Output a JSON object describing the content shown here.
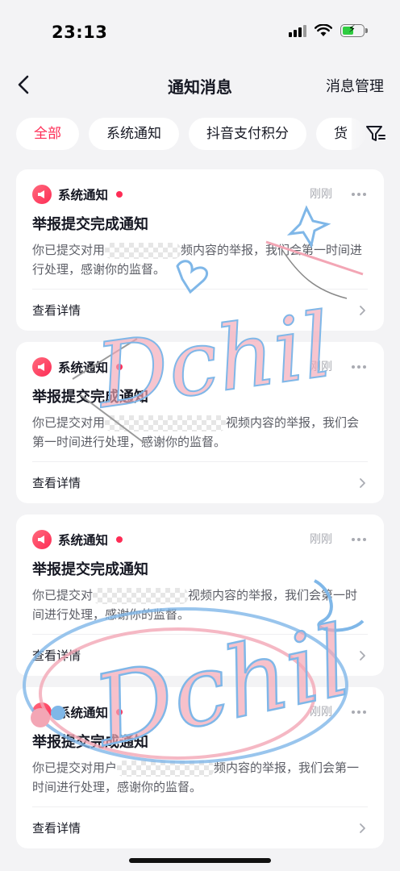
{
  "status_bar": {
    "time": "23:13"
  },
  "nav": {
    "title": "通知消息",
    "right_action": "消息管理"
  },
  "tabs": [
    {
      "label": "全部",
      "active": true
    },
    {
      "label": "系统通知",
      "active": false
    },
    {
      "label": "抖音支付积分",
      "active": false
    },
    {
      "label": "货",
      "active": false
    }
  ],
  "notifications": [
    {
      "sender": "系统通知",
      "time": "刚刚",
      "title": "举报提交完成通知",
      "body_prefix": "你已提交对用",
      "body_suffix": "频内容的举报，我们会第一时间进行处理，感谢你的监督。",
      "detail_label": "查看详情"
    },
    {
      "sender": "系统通知",
      "time": "刚刚",
      "title": "举报提交完成通知",
      "body_prefix": "你已提交对用",
      "body_suffix": "视频内容的举报，我们会第一时间进行处理，感谢你的监督。",
      "detail_label": "查看详情"
    },
    {
      "sender": "系统通知",
      "time": "刚刚",
      "title": "举报提交完成通知",
      "body_prefix": "你已提交对",
      "body_suffix": "视频内容的举报，我们会第一时间进行处理，感谢你的监督。",
      "detail_label": "查看详情"
    },
    {
      "sender": "系统通知",
      "time": "刚刚",
      "title": "举报提交完成通知",
      "body_prefix": "你已提交对用户",
      "body_suffix": "频内容的举报，我们会第一时间进行处理，感谢你的监督。",
      "detail_label": "查看详情"
    }
  ],
  "watermark": {
    "text": "Dchil"
  },
  "colors": {
    "accent": "#fe2c55",
    "background": "#f3f3f5",
    "card": "#ffffff",
    "muted": "#a9abb2"
  }
}
